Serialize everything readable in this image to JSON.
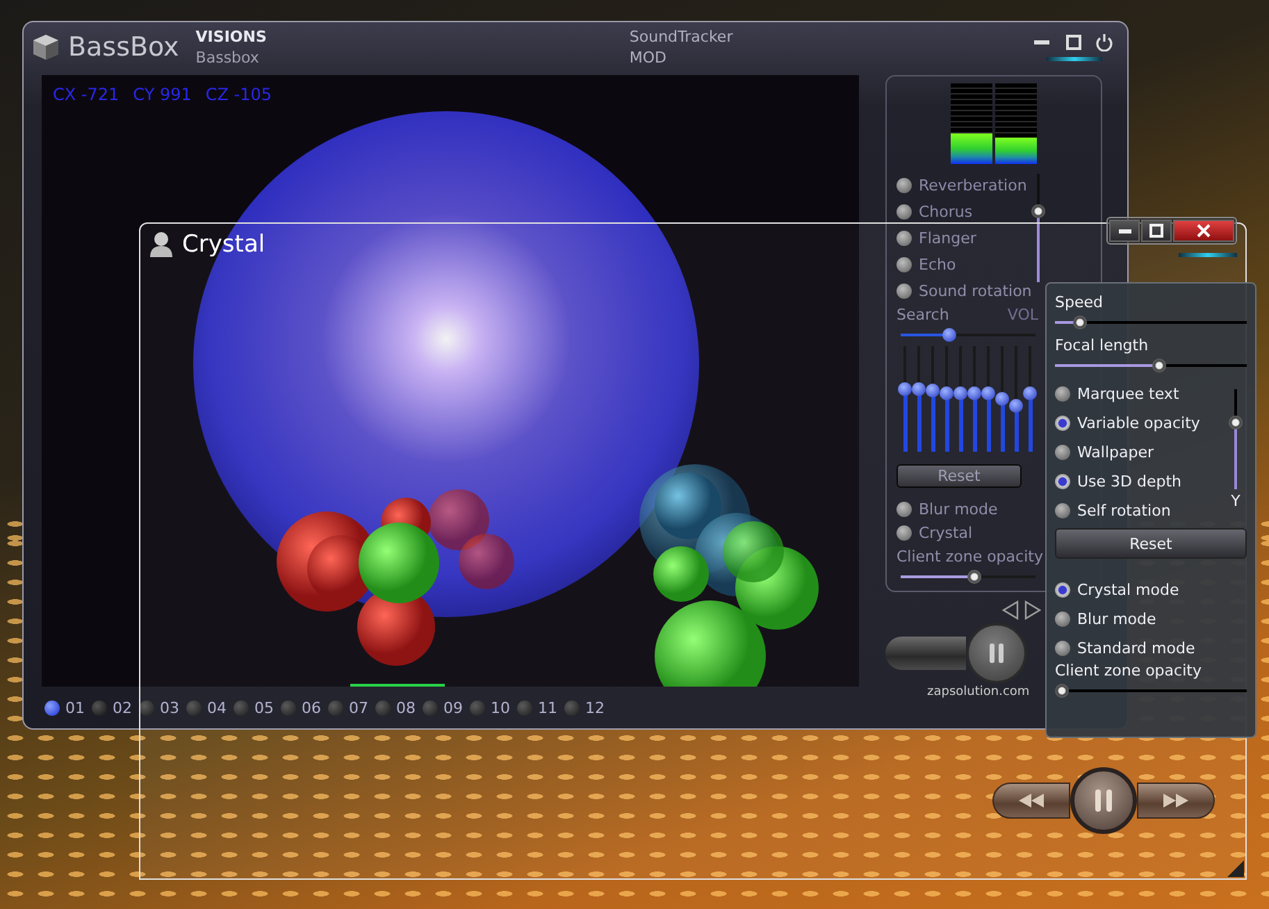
{
  "bassbox_window": {
    "logo": "BassBox",
    "brand_top": "VISIONS",
    "brand_bottom": "Bassbox",
    "track_info": [
      "SoundTracker",
      "MOD"
    ],
    "coordinates": [
      "CX -721",
      "CY 991",
      "CZ -105"
    ],
    "tracks": [
      {
        "label": "01",
        "selected": true
      },
      {
        "label": "02",
        "selected": false
      },
      {
        "label": "03",
        "selected": false
      },
      {
        "label": "04",
        "selected": false
      },
      {
        "label": "05",
        "selected": false
      },
      {
        "label": "06",
        "selected": false
      },
      {
        "label": "07",
        "selected": false
      },
      {
        "label": "08",
        "selected": false
      },
      {
        "label": "09",
        "selected": false
      },
      {
        "label": "10",
        "selected": false
      },
      {
        "label": "11",
        "selected": false
      },
      {
        "label": "12",
        "selected": false
      }
    ],
    "vu_meter": [
      {
        "level": 0.38
      },
      {
        "level": 0.33
      }
    ],
    "effects": [
      {
        "label": "Reverberation",
        "on": false
      },
      {
        "label": "Chorus",
        "on": false
      },
      {
        "label": "Flanger",
        "on": false
      },
      {
        "label": "Echo",
        "on": false
      },
      {
        "label": "Sound rotation",
        "on": false
      }
    ],
    "volume": {
      "label": "VOL",
      "level": 0.67
    },
    "search": {
      "label": "Search",
      "level": 0.35
    },
    "equalizer": [
      {
        "level": 0.6
      },
      {
        "level": 0.6
      },
      {
        "level": 0.58
      },
      {
        "level": 0.56
      },
      {
        "level": 0.56
      },
      {
        "level": 0.55
      },
      {
        "level": 0.55
      },
      {
        "level": 0.5
      },
      {
        "level": 0.42
      },
      {
        "level": 0.55
      }
    ],
    "reset_button": "Reset",
    "modes": [
      {
        "label": "Blur mode",
        "on": false
      },
      {
        "label": "Crystal",
        "on": false
      }
    ],
    "opacity": {
      "label": "Client zone opacity",
      "level": 0.55
    },
    "footer": "zapsolution.com"
  },
  "crystal_window": {
    "title": "Crystal",
    "sliders": [
      {
        "label": "Speed",
        "level": 0.1
      },
      {
        "label": "Focal length",
        "level": 0.55
      }
    ],
    "options": [
      {
        "label": "Marquee text",
        "on": false
      },
      {
        "label": "Variable opacity",
        "on": true
      },
      {
        "label": "Wallpaper",
        "on": false
      },
      {
        "label": "Use 3D depth",
        "on": true
      },
      {
        "label": "Self rotation",
        "on": false
      }
    ],
    "y_slider": {
      "label": "Y",
      "level": 0.7
    },
    "reset_button": "Reset",
    "modes": [
      {
        "label": "Crystal mode",
        "selected": true
      },
      {
        "label": "Blur mode",
        "selected": false
      },
      {
        "label": "Standard mode",
        "selected": false
      }
    ],
    "opacity": {
      "label": "Client zone opacity",
      "level": 0
    }
  }
}
